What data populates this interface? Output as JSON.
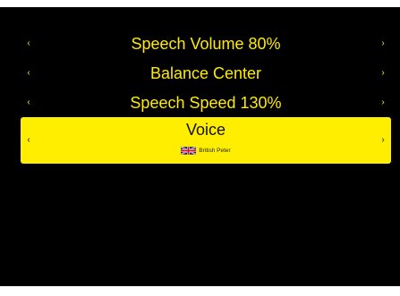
{
  "menu": {
    "items": [
      {
        "label": "Speech Volume 80%",
        "left": "‹",
        "right": "›"
      },
      {
        "label": "Balance Center",
        "left": "‹",
        "right": "›"
      },
      {
        "label": "Speech Speed 130%",
        "left": "‹",
        "right": "›"
      },
      {
        "label": "Voice",
        "left": "‹",
        "right": "›",
        "value": "British Peter",
        "flag_icon": "uk-flag-icon"
      }
    ],
    "selected_index": 3
  },
  "colors": {
    "background": "#000000",
    "text": "#ffeb00",
    "highlight": "#ffee00"
  }
}
